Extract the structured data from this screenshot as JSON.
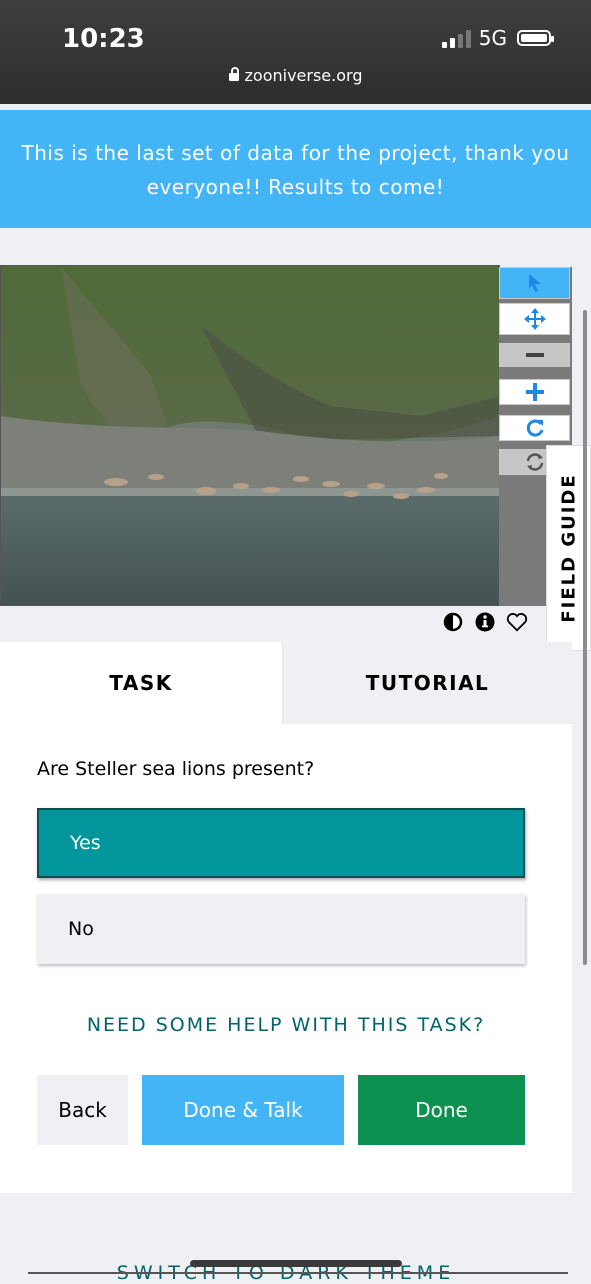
{
  "status_bar": {
    "time": "10:23",
    "network": "5G",
    "url": "zooniverse.org"
  },
  "banner": {
    "line1": "This is the last set of data for the project, thank you",
    "line2": "everyone!! Results to come!"
  },
  "toolbar": {
    "tools": [
      "pointer-icon",
      "move-icon",
      "zoom-out-icon",
      "zoom-in-icon",
      "rotate-icon",
      "reset-icon"
    ]
  },
  "field_guide": {
    "label": "FIELD GUIDE"
  },
  "meta_icons": [
    "invert-colors-icon",
    "info-icon",
    "favorite-heart-icon"
  ],
  "tabs": {
    "task": "TASK",
    "tutorial": "TUTORIAL"
  },
  "task": {
    "question": "Are Steller sea lions present?",
    "answers": [
      "Yes",
      "No"
    ],
    "selected": "Yes",
    "help_link": "NEED SOME HELP WITH THIS TASK?"
  },
  "buttons": {
    "back": "Back",
    "done_talk": "Done & Talk",
    "done": "Done"
  },
  "footer": {
    "theme_toggle": "SWITCH TO DARK THEME"
  },
  "colors": {
    "banner": "#43b5f7",
    "selected_answer": "#00969c",
    "done": "#0d9150",
    "link_teal": "#00646b"
  }
}
